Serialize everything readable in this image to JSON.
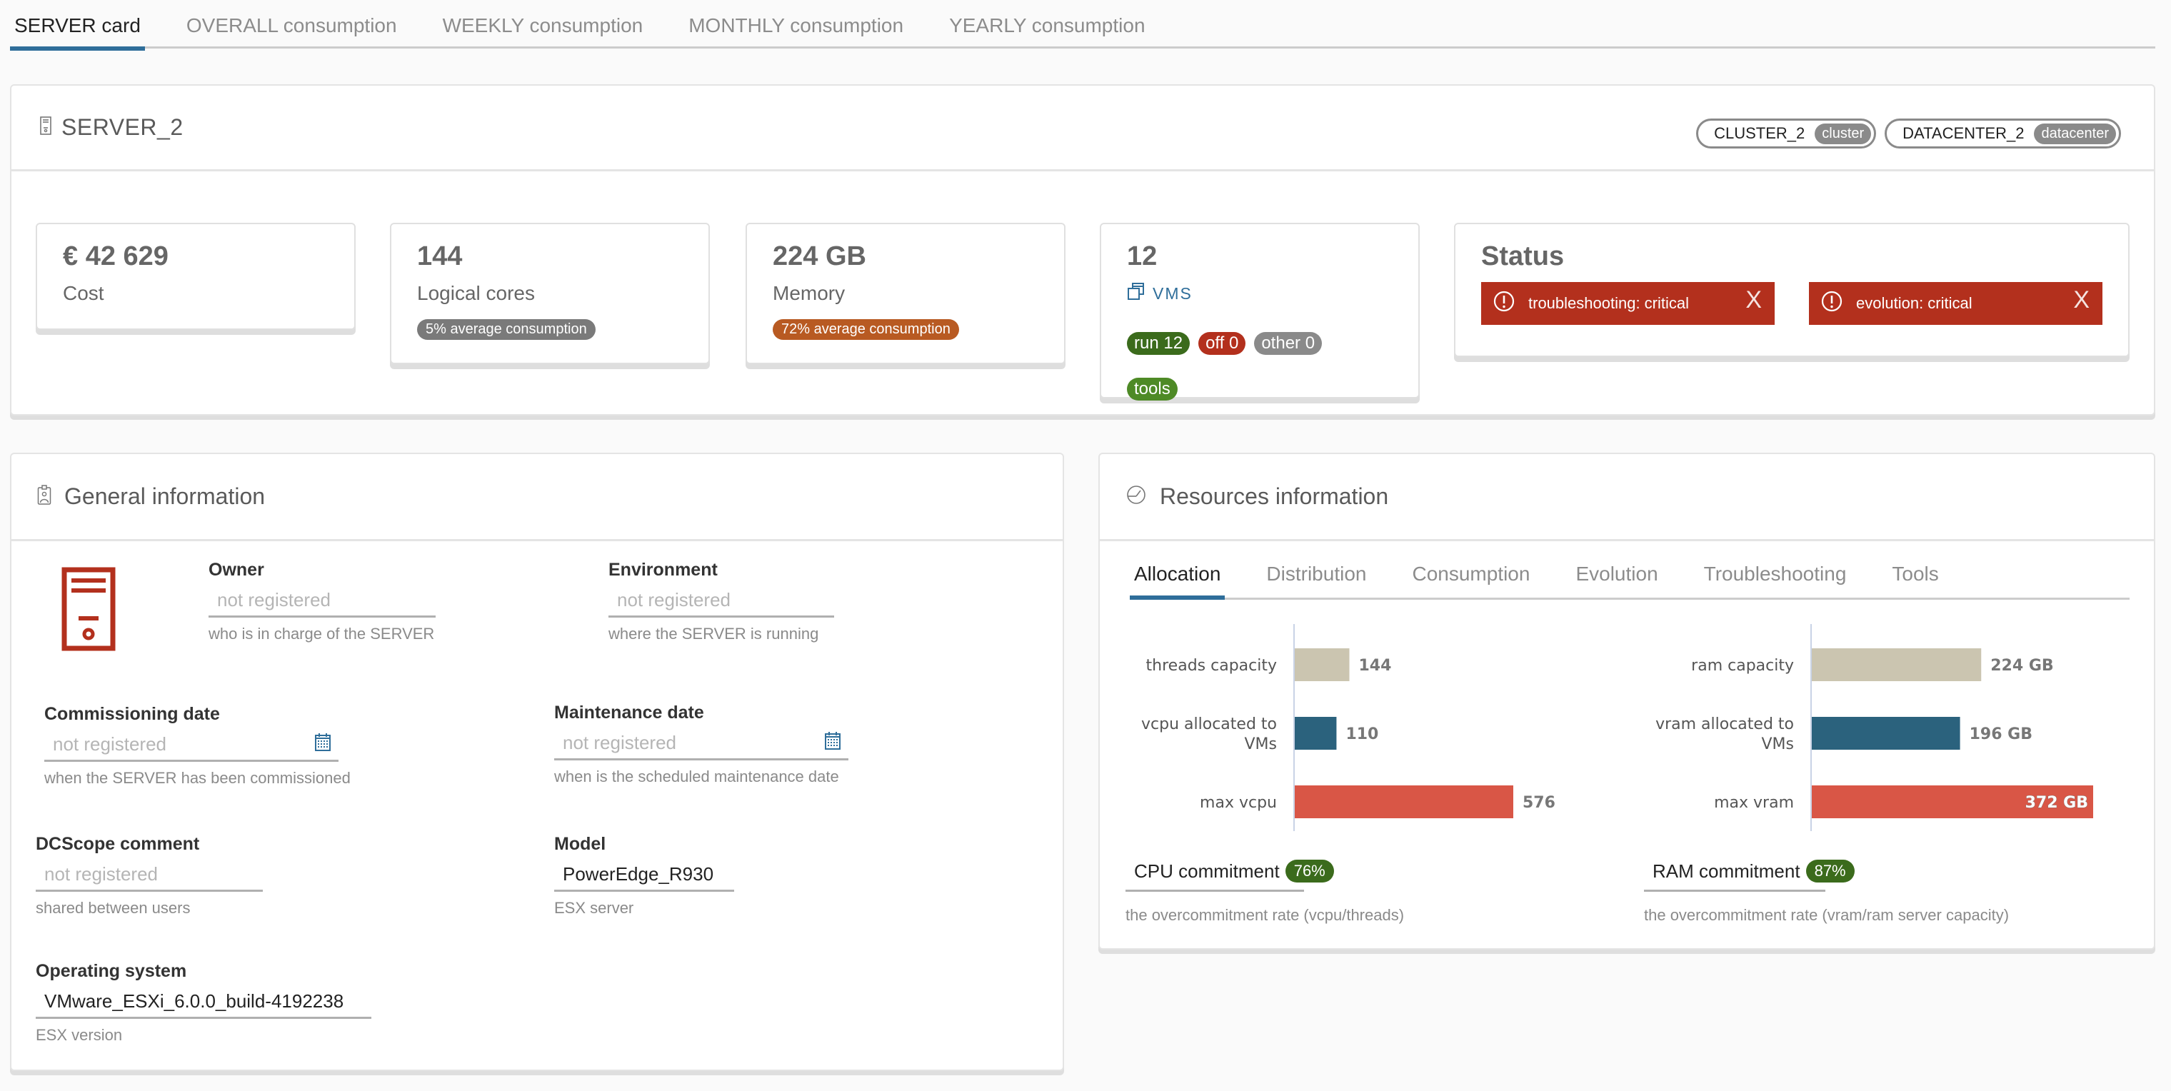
{
  "top_tabs": [
    {
      "label": "SERVER card",
      "active": true
    },
    {
      "label": "OVERALL consumption",
      "active": false
    },
    {
      "label": "WEEKLY consumption",
      "active": false
    },
    {
      "label": "MONTHLY consumption",
      "active": false
    },
    {
      "label": "YEARLY consumption",
      "active": false
    }
  ],
  "server": {
    "name": "SERVER_2",
    "chips": [
      {
        "name": "CLUSTER_2",
        "tag": "cluster"
      },
      {
        "name": "DATACENTER_2",
        "tag": "datacenter"
      }
    ]
  },
  "kpis": {
    "cost": {
      "value": "€ 42 629",
      "label": "Cost"
    },
    "cores": {
      "value": "144",
      "label": "Logical cores",
      "badge": "5% average consumption",
      "badge_color": "#7a7a7a"
    },
    "memory": {
      "value": "224 GB",
      "label": "Memory",
      "badge": "72% average consumption",
      "badge_color": "#b85a22"
    },
    "vms": {
      "value": "12",
      "link_label": "VMS",
      "badges": [
        {
          "label": "run 12",
          "color": "#3b6b1c"
        },
        {
          "label": "off 0",
          "color": "#b3301d"
        },
        {
          "label": "other 0",
          "color": "#8a8a8a"
        },
        {
          "label": "tools",
          "color": "#4e8a26"
        }
      ]
    },
    "status": {
      "title": "Status",
      "alerts": [
        {
          "text": "troubleshooting: critical",
          "close": "X"
        },
        {
          "text": "evolution: critical",
          "close": "X"
        }
      ],
      "alert_color": "#b3301d"
    }
  },
  "general": {
    "title": "General information",
    "fields": {
      "owner": {
        "label": "Owner",
        "placeholder": "not registered",
        "value": "",
        "help": "who is in charge of the SERVER"
      },
      "environment": {
        "label": "Environment",
        "placeholder": "not registered",
        "value": "",
        "help": "where the SERVER is running"
      },
      "commissioning": {
        "label": "Commissioning date",
        "placeholder": "not registered",
        "value": "",
        "help": "when the SERVER has been commissioned"
      },
      "maintenance": {
        "label": "Maintenance date",
        "placeholder": "not registered",
        "value": "",
        "help": "when is the scheduled maintenance date"
      },
      "comment": {
        "label": "DCScope comment",
        "placeholder": "not registered",
        "value": "",
        "help": "shared between users"
      },
      "model": {
        "label": "Model",
        "placeholder": "",
        "value": "PowerEdge_R930",
        "help": "ESX server"
      },
      "os": {
        "label": "Operating system",
        "placeholder": "",
        "value": "VMware_ESXi_6.0.0_build-4192238",
        "help": "ESX version"
      }
    }
  },
  "resources": {
    "title": "Resources information",
    "tabs": [
      {
        "label": "Allocation",
        "active": true
      },
      {
        "label": "Distribution",
        "active": false
      },
      {
        "label": "Consumption",
        "active": false
      },
      {
        "label": "Evolution",
        "active": false
      },
      {
        "label": "Troubleshooting",
        "active": false
      },
      {
        "label": "Tools",
        "active": false
      }
    ],
    "cpu_commitment": {
      "label": "CPU commitment",
      "value": "76%",
      "help": "the overcommitment rate (vcpu/threads)"
    },
    "ram_commitment": {
      "label": "RAM commitment",
      "value": "87%",
      "help": "the overcommitment rate (vram/ram server capacity)"
    }
  },
  "chart_data": [
    {
      "type": "bar",
      "orientation": "horizontal",
      "title": "",
      "categories": [
        "threads capacity",
        "vcpu allocated to VMs",
        "max vcpu"
      ],
      "values": [
        144,
        110,
        576
      ],
      "value_labels": [
        "144",
        "110",
        "576"
      ],
      "colors": [
        "#cbc5b0",
        "#2b627d",
        "#d95646"
      ],
      "xlim": [
        0,
        576
      ],
      "grid": false
    },
    {
      "type": "bar",
      "orientation": "horizontal",
      "title": "",
      "categories": [
        "ram capacity",
        "vram allocated to VMs",
        "max vram"
      ],
      "values": [
        224,
        196,
        372
      ],
      "unit": "GB",
      "value_labels": [
        "224 GB",
        "196 GB",
        "372 GB"
      ],
      "colors": [
        "#cbc5b0",
        "#2b627d",
        "#d95646"
      ],
      "xlim": [
        0,
        372
      ],
      "grid": false
    }
  ]
}
